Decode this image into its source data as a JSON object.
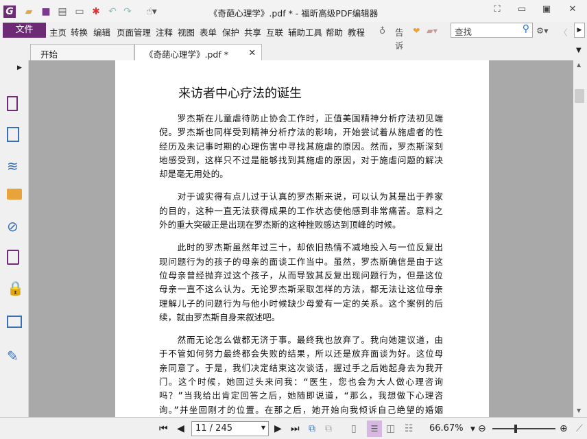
{
  "window": {
    "title": "《奇葩心理学》.pdf * - 福昕高级PDF编辑器"
  },
  "menu": {
    "file": "文件",
    "items": [
      "主页",
      "转换",
      "编辑",
      "页面管理",
      "注释",
      "视图",
      "表单",
      "保护",
      "共享",
      "互联",
      "辅助工具",
      "帮助",
      "教程"
    ],
    "tell_me": "告诉",
    "search_placeholder": "查找"
  },
  "tabs": [
    {
      "label": "开始"
    },
    {
      "label": "《奇葩心理学》.pdf *"
    }
  ],
  "document": {
    "title": "来访者中心疗法的诞生",
    "paragraphs": [
      {
        "style": "normal",
        "lines": [
          "　　罗杰斯在儿童虐待防止协会工作时，正值美国精神分析疗法初见端",
          "倪。罗杰斯也同样受到精神分析疗法的影响，开始尝试着从施虐者的性",
          "经历及未记事时期的心理伤害中寻找其施虐的原因。然而，罗杰斯深刻",
          "地感受到，这样只不过是能够找到其施虐的原因，对于施虐问题的解决",
          "却是毫无用处的。"
        ]
      },
      {
        "style": "normal",
        "lines": [
          "　　对于诚实得有点儿过于认真的罗杰斯来说，可以认为其是出于养家",
          "的目的，这种一直无法获得成果的工作状态使他感到非常痛苦。意料之",
          "外的重大突破正是出现在罗杰斯的这种挫败感达到顶峰的时候。"
        ]
      },
      {
        "style": "normal",
        "lines": [
          "　　此时的罗杰斯虽然年过三十，却依旧热情不减地投入与一位反复出",
          "现问题行为的孩子的母亲的面谈工作当中。虽然，罗杰斯确信是由于这",
          "位母亲曾经抛弃过这个孩子，从而导致其反复出现问题行为，但是这位",
          "母亲一直不这么认为。无论罗杰斯采取怎样的方法，都无法让这位母亲",
          "理解儿子的问题行为与他小时候缺少母爱有一定的关系。这个案例的后",
          "续，就由罗杰斯自身来叙述吧。"
        ]
      },
      {
        "style": "alt",
        "lines": [
          "　　然而无论怎么做都无济于事。最终我也放弃了。我向她建议道，由",
          "于不管如何努力最终都会失败的结果，所以还是放弃面谈为好。这位母",
          "亲同意了。于是，我们决定结束这次谈话，握过手之后她起身去为我开",
          "门。这个时候，她回过头来问我：“医生，您也会为大人做心理咨询",
          "吗？”当我给出肯定回答之后，她随即说道，“那么，我想做下心理咨",
          "询。”并坐回刚才的位置。在那之后，她开始向我倾诉自己绝望的婚姻"
        ]
      }
    ]
  },
  "status": {
    "page": "11 / 245",
    "zoom": "66.67%"
  },
  "colors": {
    "accent": "#6c2b74",
    "viewer_bg": "#a9a9a9"
  }
}
